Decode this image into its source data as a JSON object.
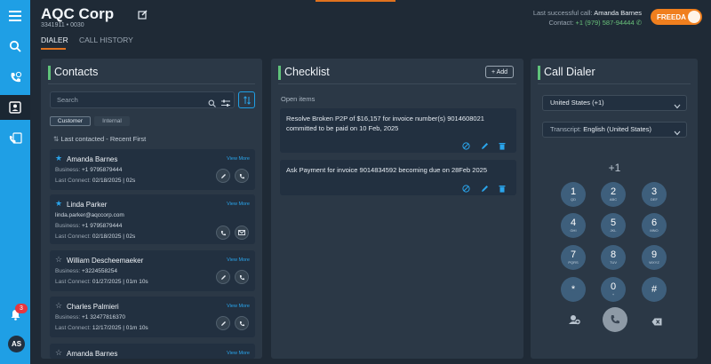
{
  "app": {
    "title": "AQC Corp",
    "account_id": "3341911 • 0030",
    "tabs": [
      "DIALER",
      "CALL HISTORY"
    ],
    "last_call_label": "Last successful call:",
    "last_call_name": "Amanda Barnes",
    "contact_label": "Contact:",
    "contact_number": "+1 (979) 587-94444",
    "freeda_label": "FREEDA",
    "notification_count": "3",
    "avatar_initials": "AS",
    "accent": "#e0721f",
    "rail_color": "#1f9fe5"
  },
  "contacts": {
    "title": "Contacts",
    "search_placeholder": "Search",
    "filters": [
      "Customer",
      "Internal"
    ],
    "sort_label": "Last contacted - Recent First",
    "view_more": "View More",
    "business_label": "Business:",
    "last_connect_label": "Last Connect:",
    "items": [
      {
        "name": "Amanda Barnes",
        "starred": true,
        "email": "",
        "business": "+1 9795879444",
        "last_connect": "02/18/2025 | 02s"
      },
      {
        "name": "Linda Parker",
        "starred": true,
        "email": "linda.parker@aqccorp.com",
        "business": "+1 9795879444",
        "last_connect": "02/18/2025 | 02s"
      },
      {
        "name": "William Descheemaeker",
        "starred": false,
        "email": "",
        "business": "+3224558254",
        "last_connect": "01/27/2025 | 01m 10s"
      },
      {
        "name": "Charles Palmieri",
        "starred": false,
        "email": "",
        "business": "+1 32477816370",
        "last_connect": "12/17/2025 | 01m 10s"
      },
      {
        "name": "Amanda Barnes",
        "starred": false,
        "email": "",
        "business": "",
        "last_connect": ""
      }
    ]
  },
  "checklist": {
    "title": "Checklist",
    "add_label": "+ Add",
    "section_label": "Open items",
    "items": [
      {
        "text": "Resolve Broken P2P of $16,157 for invoice number(s) 9014608021 committed to be paid on 10 Feb, 2025"
      },
      {
        "text": "Ask Payment for invoice 9014834592 becoming due on 28Feb 2025"
      }
    ]
  },
  "dialer": {
    "title": "Call Dialer",
    "country": "United States (+1)",
    "transcript_label": "Transcript:",
    "transcript_value": "English (United States)",
    "display": "+1",
    "keys": [
      {
        "d": "1",
        "l": "QD"
      },
      {
        "d": "2",
        "l": "ABC"
      },
      {
        "d": "3",
        "l": "DEF"
      },
      {
        "d": "4",
        "l": "GHI"
      },
      {
        "d": "5",
        "l": "JKL"
      },
      {
        "d": "6",
        "l": "MNO"
      },
      {
        "d": "7",
        "l": "PQRS"
      },
      {
        "d": "8",
        "l": "TUV"
      },
      {
        "d": "9",
        "l": "WXYZ"
      },
      {
        "d": "*",
        "l": ""
      },
      {
        "d": "0",
        "l": "+"
      },
      {
        "d": "#",
        "l": ""
      }
    ]
  }
}
